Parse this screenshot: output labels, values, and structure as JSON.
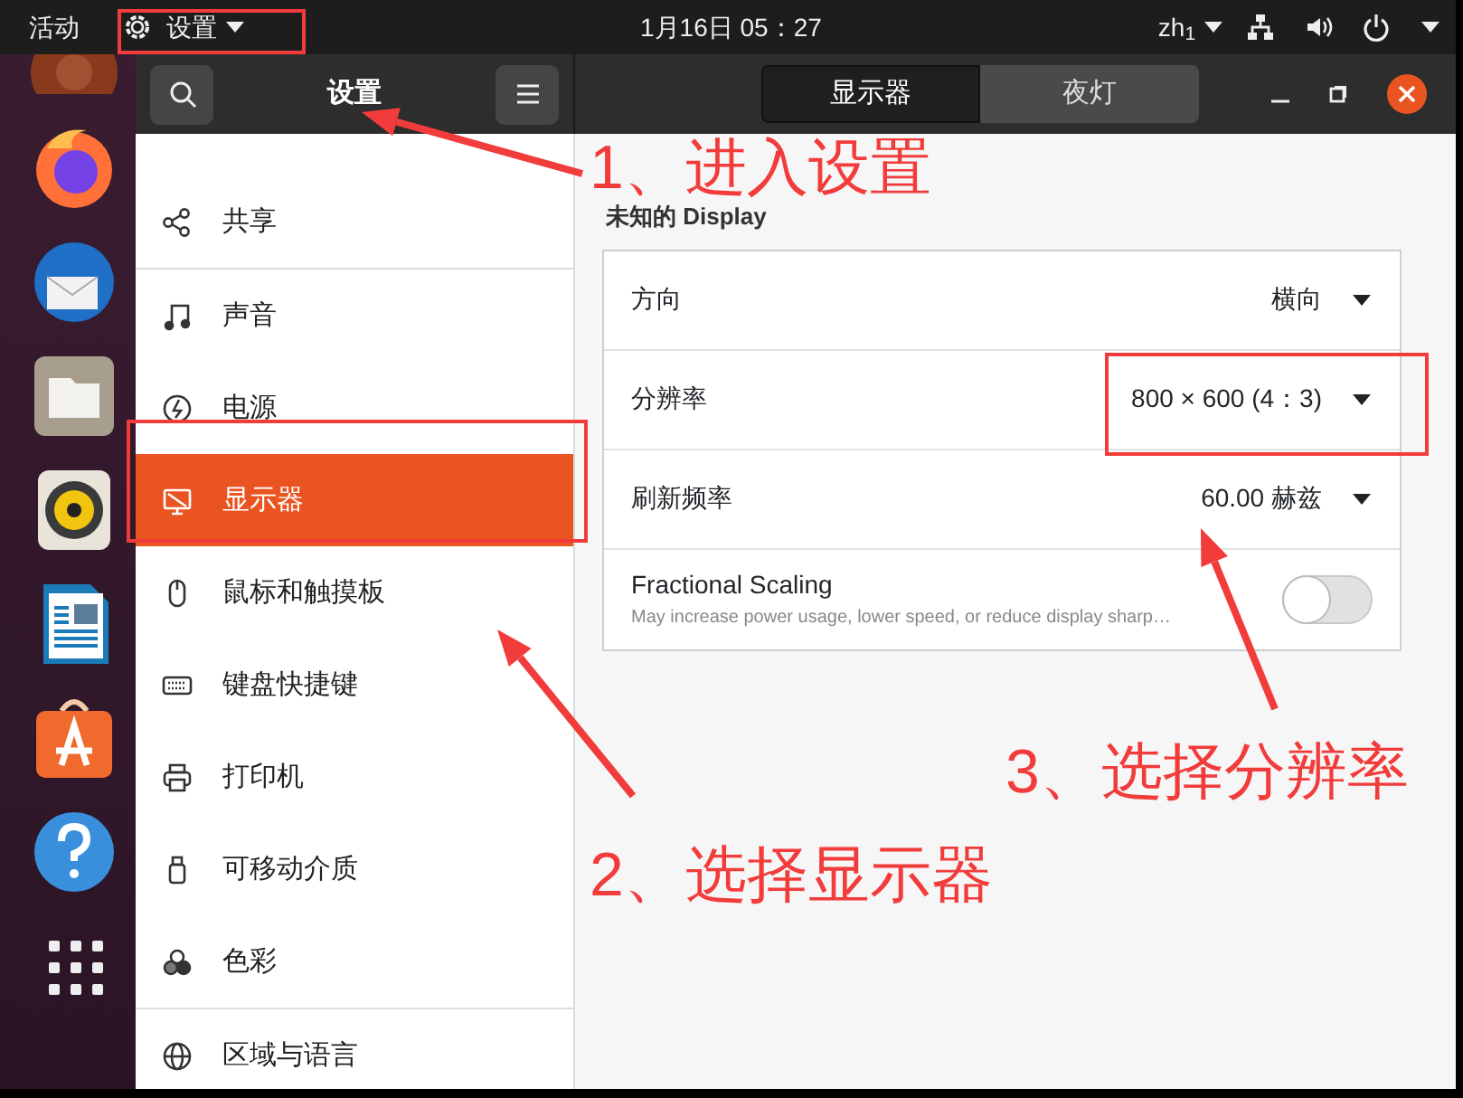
{
  "top_bar": {
    "activities": "活动",
    "app_menu": "设置",
    "clock": "1月16日 05：27",
    "input_method": "zh$_{1}$"
  },
  "dock": [
    {
      "kind": "ubuntu"
    },
    {
      "kind": "firefox"
    },
    {
      "kind": "mail"
    },
    {
      "kind": "files"
    },
    {
      "kind": "speaker"
    },
    {
      "kind": "writer"
    },
    {
      "kind": "store"
    },
    {
      "kind": "help"
    },
    {
      "kind": "grid"
    }
  ],
  "sidebar": {
    "title": "设置",
    "groups": [
      [
        {
          "label": "共享",
          "kind": "share",
          "selected": false
        }
      ],
      [
        {
          "label": "声音",
          "kind": "music",
          "selected": false
        },
        {
          "label": "电源",
          "kind": "power",
          "selected": false
        },
        {
          "label": "显示器",
          "kind": "display",
          "selected": true
        },
        {
          "label": "鼠标和触摸板",
          "kind": "mouse",
          "selected": false
        },
        {
          "label": "键盘快捷键",
          "kind": "keyboard",
          "selected": false
        },
        {
          "label": "打印机",
          "kind": "printer",
          "selected": false
        },
        {
          "label": "可移动介质",
          "kind": "usb",
          "selected": false
        },
        {
          "label": "色彩",
          "kind": "color",
          "selected": false
        }
      ],
      [
        {
          "label": "区域与语言",
          "kind": "globe",
          "selected": false
        }
      ]
    ]
  },
  "tabs": [
    {
      "label": "显示器",
      "selected": true
    },
    {
      "label": "夜灯",
      "selected": false
    }
  ],
  "section_title": "未知的 Display",
  "settings": [
    {
      "kind": "dropdown",
      "label": "方向",
      "value": "横向"
    },
    {
      "kind": "dropdown",
      "label": "分辨率",
      "value": "800 × 600 (4：3)"
    },
    {
      "kind": "dropdown",
      "label": "刷新频率",
      "value": "60.00 赫兹"
    },
    {
      "kind": "switch",
      "label": "Fractional Scaling",
      "description": "May increase power usage, lower speed, or reduce display sharp…",
      "on": false
    }
  ],
  "annotations": [
    {
      "text": "1、进入设置"
    },
    {
      "text": "2、选择显示器"
    },
    {
      "text": "3、选择分辨率"
    }
  ]
}
